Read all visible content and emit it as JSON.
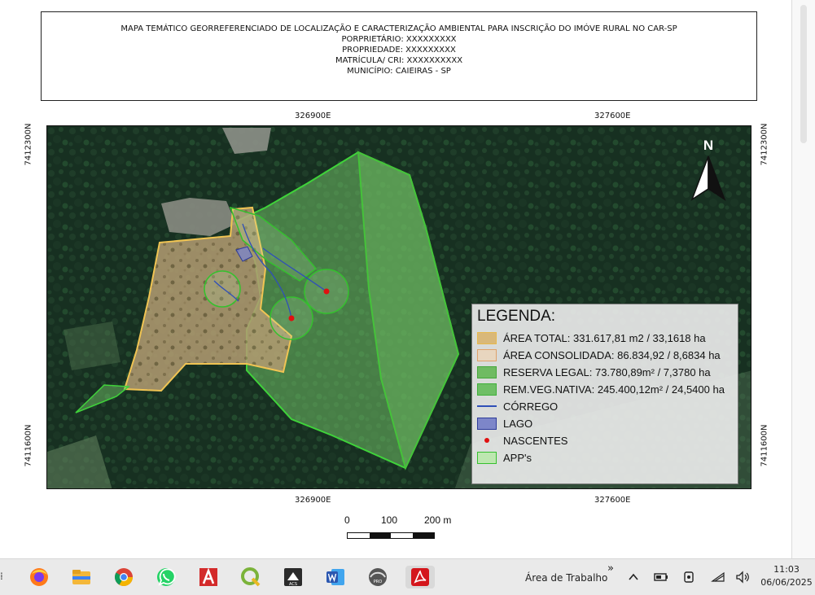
{
  "map": {
    "title_lines": [
      "MAPA TEMÁTICO GEORREFERENCIADO DE LOCALIZAÇÃO E CARACTERIZAÇÃO AMBIENTAL PARA INSCRIÇÃO DO IMÓVE RURAL NO CAR-SP",
      "PORPRIETÁRIO: XXXXXXXXX",
      "PROPRIEDADE: XXXXXXXXX",
      "MATRÍCULA/ CRI: XXXXXXXXXX",
      "MUNICÍPIO: CAIEIRAS - SP"
    ],
    "coords": {
      "easting_left": "326900E",
      "easting_right": "327600E",
      "northing_top": "7412300N",
      "northing_bottom": "7411600N"
    },
    "north_label": "N",
    "legend": {
      "title": "LEGENDA:",
      "items": [
        {
          "label": "ÁREA TOTAL: 331.617,81 m2  /  33,1618 ha",
          "fill": "#d9b879",
          "stroke": "#e8b94c",
          "kind": "fill"
        },
        {
          "label": "ÁREA CONSOLIDADA: 86.834,92 / 8,6834 ha",
          "fill": "#e8d6bf",
          "stroke": "#e0a26a",
          "kind": "fill"
        },
        {
          "label": "RESERVA LEGAL: 73.780,89m² / 7,3780 ha",
          "fill": "#6fbb62",
          "stroke": "#45a83a",
          "kind": "fill"
        },
        {
          "label": "REM.VEG.NATIVA: 245.400,12m² / 24,5400 ha",
          "fill": "#6fbf66",
          "stroke": "#3fb03a",
          "kind": "fill"
        },
        {
          "label": "CÓRREGO",
          "fill": "",
          "stroke": "#2f4fb8",
          "kind": "line"
        },
        {
          "label": "LAGO",
          "fill": "#7d86c9",
          "stroke": "#2d3b9a",
          "kind": "fill"
        },
        {
          "label": "NASCENTES",
          "fill": "#e01010",
          "stroke": "",
          "kind": "dot"
        },
        {
          "label": "APP's",
          "fill": "#bde7b0",
          "stroke": "#35c12e",
          "kind": "fill"
        }
      ]
    },
    "scale": {
      "labels": [
        "0",
        "100",
        "200 m"
      ],
      "unit": "m"
    }
  },
  "taskbar": {
    "apps": [
      {
        "name": "firefox",
        "color": "#ff7a1a"
      },
      {
        "name": "file-explorer",
        "color": "#f3b73a"
      },
      {
        "name": "chrome",
        "color": "#3b82f6"
      },
      {
        "name": "whatsapp",
        "color": "#25d366"
      },
      {
        "name": "autocad",
        "color": "#d32a2a"
      },
      {
        "name": "qgis",
        "color": "#7bb33a"
      },
      {
        "name": "acs",
        "color": "#2b2b2b"
      },
      {
        "name": "word",
        "color": "#2b57b0"
      },
      {
        "name": "pro",
        "color": "#555555"
      },
      {
        "name": "acrobat",
        "color": "#d4161c"
      }
    ],
    "desktop_label": "Área de Trabalho",
    "overflow_glyph": "»",
    "time": "11:03",
    "date": "06/06/2025"
  }
}
